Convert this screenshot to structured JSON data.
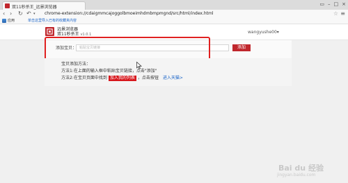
{
  "browser": {
    "tab_title": "双11秒杀王_远景浏览器",
    "url": "chrome-extension://cdaigmmcajoggolbmoeimhdmbmpmgnd/src/html/index.html",
    "window_controls": [
      "▭",
      "–",
      "□",
      "×"
    ]
  },
  "bookmarks": {
    "apps_label": "应用",
    "hint": "单击这里导入已有的收藏夹内容"
  },
  "header": {
    "brand": "远景浏览器",
    "subtitle": "双11秒杀王",
    "version": "v1.0.1",
    "user": "wangyushe00▾"
  },
  "add_panel": {
    "label": "添加宝贝：",
    "input_placeholder": "粘贴宝贝链接",
    "input_value": "",
    "button_label": "添加"
  },
  "help": {
    "title": "宝贝添加方法：",
    "method1": "方法1:在上面的输入框中粘贴宝贝链接，点击\"添加\"",
    "method2_prefix": "方法2:在宝贝页面中找到",
    "cart_tag": "加入我的列表",
    "method2_suffix": "，点击按钮",
    "tmall_link": "进入天猫>"
  },
  "watermark": {
    "main": "Bai du 经验",
    "sub": "jingyan.baidu.com"
  },
  "colors": {
    "brand_red": "#c0272d",
    "highlight_red": "#e02020",
    "link_blue": "#1a64c8"
  }
}
